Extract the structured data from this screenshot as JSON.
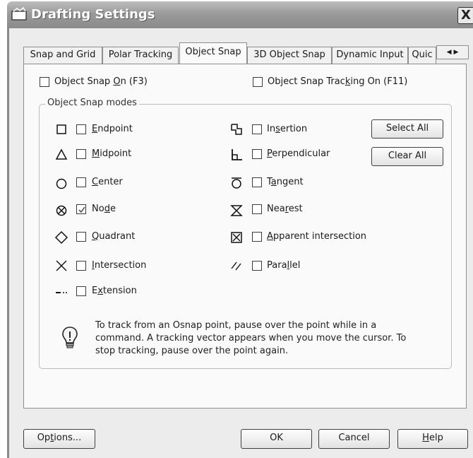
{
  "window": {
    "title": "Drafting Settings",
    "close_glyph": "X"
  },
  "tabs": [
    {
      "label": "Snap and Grid"
    },
    {
      "label": "Polar Tracking"
    },
    {
      "label": "Object Snap"
    },
    {
      "label": "3D Object Snap"
    },
    {
      "label": "Dynamic Input"
    },
    {
      "label": "Quic"
    }
  ],
  "tab_scroll": {
    "left": "◀",
    "right": "▶"
  },
  "top_options": {
    "snap_on": {
      "before": "Object Snap ",
      "mnemonic": "O",
      "after": "n (F3)",
      "checked": false
    },
    "tracking_on": {
      "before": "Object Snap Trac",
      "mnemonic": "k",
      "after": "ing On (F11)",
      "checked": false
    }
  },
  "group": {
    "title": "Object Snap modes"
  },
  "modes_left": [
    {
      "icon": "square-marker-icon",
      "before": "",
      "mnemonic": "E",
      "after": "ndpoint",
      "checked": false
    },
    {
      "icon": "triangle-marker-icon",
      "before": "",
      "mnemonic": "M",
      "after": "idpoint",
      "checked": false
    },
    {
      "icon": "circle-marker-icon",
      "before": "",
      "mnemonic": "C",
      "after": "enter",
      "checked": false
    },
    {
      "icon": "node-marker-icon",
      "before": "No",
      "mnemonic": "d",
      "after": "e",
      "checked": true
    },
    {
      "icon": "diamond-marker-icon",
      "before": "",
      "mnemonic": "Q",
      "after": "uadrant",
      "checked": false
    },
    {
      "icon": "x-marker-icon",
      "before": "",
      "mnemonic": "I",
      "after": "ntersection",
      "checked": false
    },
    {
      "icon": "extension-marker-icon",
      "before": "E",
      "mnemonic": "x",
      "after": "tension",
      "checked": false
    }
  ],
  "modes_right": [
    {
      "icon": "insertion-marker-icon",
      "before": "In",
      "mnemonic": "s",
      "after": "ertion",
      "checked": false
    },
    {
      "icon": "perpendicular-marker-icon",
      "before": "",
      "mnemonic": "P",
      "after": "erpendicular",
      "checked": false
    },
    {
      "icon": "tangent-marker-icon",
      "before": "T",
      "mnemonic": "a",
      "after": "ngent",
      "checked": false
    },
    {
      "icon": "nearest-marker-icon",
      "before": "Nea",
      "mnemonic": "r",
      "after": "est",
      "checked": false
    },
    {
      "icon": "apparent-intersection-marker-icon",
      "before": "",
      "mnemonic": "A",
      "after": "pparent intersection",
      "checked": false
    },
    {
      "icon": "parallel-marker-icon",
      "before": "Para",
      "mnemonic": "l",
      "after": "lel",
      "checked": false
    }
  ],
  "side_buttons": {
    "select_all": "Select All",
    "clear_all": "Clear All"
  },
  "hint": {
    "icon": "lightbulb-icon",
    "text": "To track from an Osnap point, pause over the point while in a command.  A tracking vector appears when you move the cursor. To stop tracking, pause over the point again."
  },
  "footer": {
    "options": {
      "before": "Op",
      "mnemonic": "t",
      "after": "ions..."
    },
    "ok": "OK",
    "cancel": "Cancel",
    "help": {
      "before": "",
      "mnemonic": "H",
      "after": "elp"
    }
  }
}
